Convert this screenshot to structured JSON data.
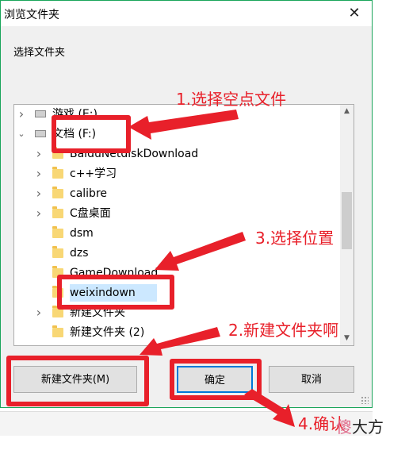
{
  "window": {
    "title": "浏览文件夹",
    "close_icon": "close-icon",
    "prompt": "选择文件夹"
  },
  "tree": {
    "nodes": [
      {
        "label": "游戏 (E:)",
        "icon": "drive-icon",
        "expander": "chevron-right",
        "level": 0
      },
      {
        "label": "文档 (F:)",
        "icon": "drive-icon",
        "expander": "chevron-down",
        "level": 0
      },
      {
        "label": "BaiduNetdiskDownload",
        "icon": "folder-icon",
        "expander": "chevron-right",
        "level": 1
      },
      {
        "label": "c++学习",
        "icon": "folder-icon",
        "expander": "chevron-right",
        "level": 1
      },
      {
        "label": "calibre",
        "icon": "folder-icon",
        "expander": "chevron-right",
        "level": 1
      },
      {
        "label": "C盘桌面",
        "icon": "folder-icon",
        "expander": "chevron-right",
        "level": 1
      },
      {
        "label": "dsm",
        "icon": "folder-icon",
        "expander": "",
        "level": 1
      },
      {
        "label": "dzs",
        "icon": "folder-icon",
        "expander": "",
        "level": 1
      },
      {
        "label": "GameDownload",
        "icon": "folder-icon",
        "expander": "",
        "level": 1
      },
      {
        "label": "weixindown",
        "icon": "folder-icon",
        "expander": "",
        "level": 1,
        "selected": true
      },
      {
        "label": "新建文件夹",
        "icon": "folder-icon",
        "expander": "chevron-right",
        "level": 1
      },
      {
        "label": "新建文件夹 (2)",
        "icon": "folder-icon",
        "expander": "",
        "level": 1
      }
    ]
  },
  "buttons": {
    "new_folder": "新建文件夹(M)",
    "ok": "确定",
    "cancel": "取消"
  },
  "annotations": {
    "step1": "1.选择空点文件",
    "step2": "2.新建文件夹啊",
    "step3": "3.选择位置",
    "step4": "4.确认"
  },
  "watermark": {
    "first": "傻",
    "rest": "大方"
  },
  "colors": {
    "annotation_red": "#e8202a",
    "selection": "#cce8ff",
    "dialog_border": "#1aa55a",
    "folder": "#f8d775",
    "primary_button_border": "#0078d7"
  }
}
